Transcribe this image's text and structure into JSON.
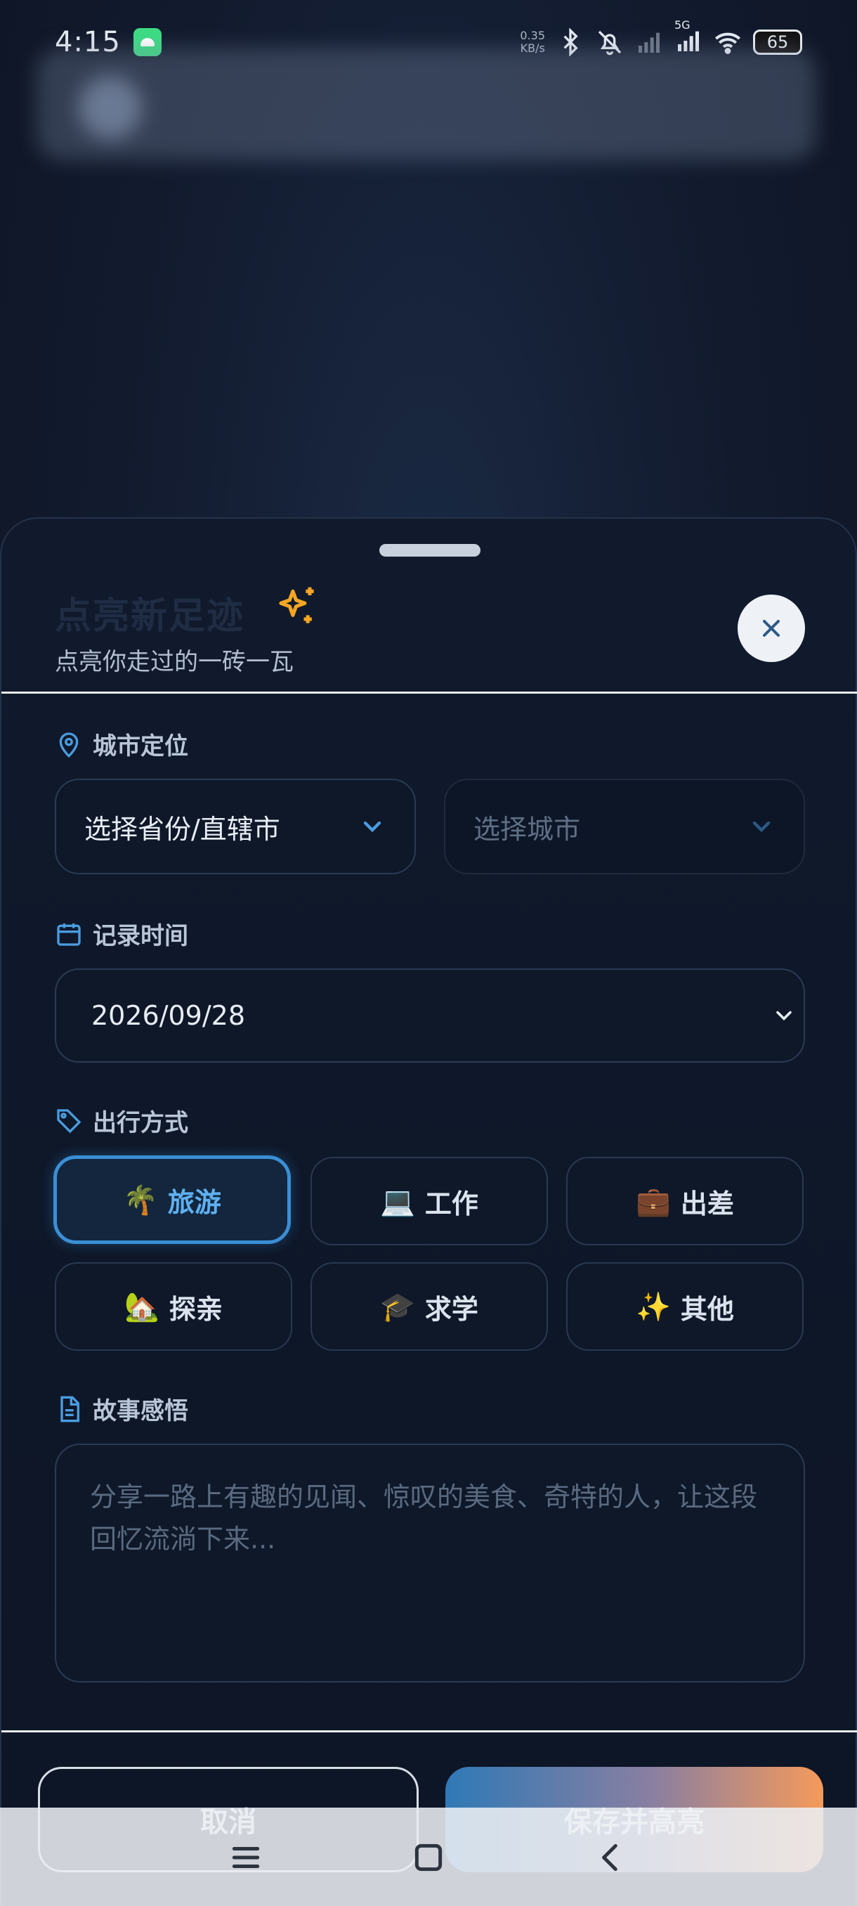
{
  "status_bar": {
    "time": "4:15",
    "net_speed_value": "0.35",
    "net_speed_unit": "KB/s",
    "network": "5G",
    "battery": "65"
  },
  "sheet": {
    "title": "点亮新足迹",
    "subtitle": "点亮你走过的一砖一瓦",
    "sections": {
      "location": "城市定位",
      "time": "记录时间",
      "mode": "出行方式",
      "story": "故事感悟"
    },
    "province_select": "选择省份/直辖市",
    "city_select": "选择城市",
    "date": "2026/09/28",
    "modes": [
      {
        "emoji": "🌴",
        "label": "旅游"
      },
      {
        "emoji": "💻",
        "label": "工作"
      },
      {
        "emoji": "💼",
        "label": "出差"
      },
      {
        "emoji": "🏡",
        "label": "探亲"
      },
      {
        "emoji": "🎓",
        "label": "求学"
      },
      {
        "emoji": "✨",
        "label": "其他"
      }
    ],
    "selected_mode": "旅游",
    "story_placeholder": "分享一路上有趣的见闻、惊叹的美食、奇特的人，让这段回忆流淌下来...",
    "cancel_label": "取消",
    "save_label": "保存并高亮"
  },
  "colors": {
    "accent": "#3a8fd6",
    "sparkle": "#f5a623",
    "save_gradient_start": "#2f79b6",
    "save_gradient_end": "#f59a5a"
  }
}
